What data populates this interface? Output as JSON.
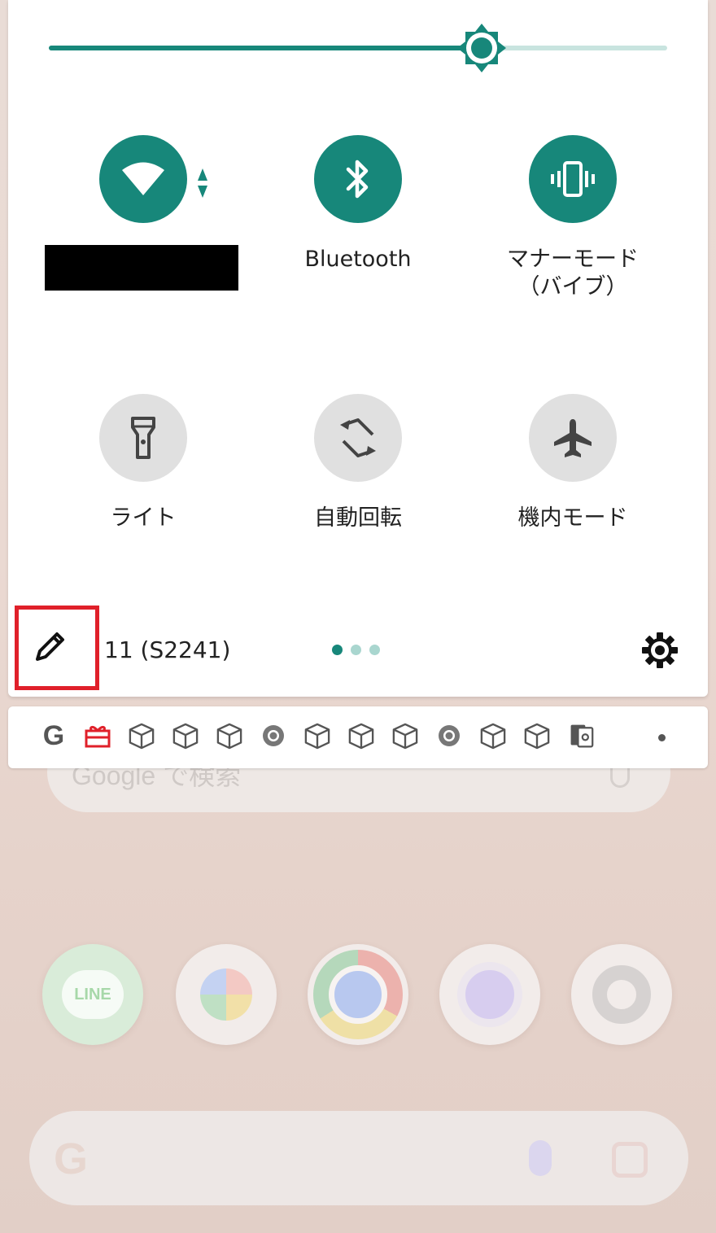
{
  "colors": {
    "accent": "#17877a",
    "accent_light": "#c8e4df",
    "tile_off": "#e0e0e0",
    "highlight": "#e0202a"
  },
  "home_screen": {
    "search_placeholder": "Google で検索",
    "dock_apps": [
      "LINE",
      "Photos",
      "Chrome",
      "Camera",
      "Settings"
    ],
    "line_label": "LINE",
    "google_letter": "G"
  },
  "quick_settings": {
    "brightness": {
      "level": 0.7
    },
    "tiles": [
      {
        "id": "wifi",
        "label": "",
        "state": "on",
        "icon": "wifi-icon"
      },
      {
        "id": "bluetooth",
        "label": "Bluetooth",
        "state": "on",
        "icon": "bluetooth-icon"
      },
      {
        "id": "manner",
        "label": "マナーモード\n（バイブ）",
        "state": "on",
        "icon": "vibrate-icon"
      },
      {
        "id": "flashlight",
        "label": "ライト",
        "state": "off",
        "icon": "flashlight-icon"
      },
      {
        "id": "autorotate",
        "label": "自動回転",
        "state": "off",
        "icon": "rotate-icon"
      },
      {
        "id": "airplane",
        "label": "機内モード",
        "state": "off",
        "icon": "airplane-icon"
      }
    ],
    "footer": {
      "build_number": "11 (S2241)",
      "pages": 3,
      "active_page": 0
    }
  },
  "notification_icons": {
    "google_letter": "G",
    "icons": [
      "google-icon",
      "gift-icon",
      "package-icon",
      "package-icon",
      "package-icon",
      "chrome-icon",
      "package-icon",
      "package-icon",
      "package-icon",
      "chrome-icon",
      "package-icon",
      "package-icon",
      "sim-settings-icon"
    ]
  }
}
